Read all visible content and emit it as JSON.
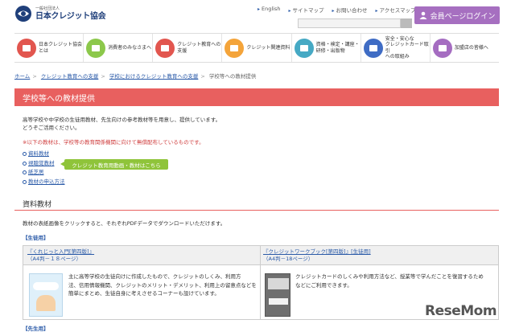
{
  "header": {
    "logo_small": "一般社団法人",
    "logo_main": "日本クレジット協会",
    "util_links": [
      "English",
      "サイトマップ",
      "お問い合わせ",
      "アクセスマップ"
    ],
    "login_label": "会員ページログイン"
  },
  "nav": [
    {
      "label": "日本クレジット協会\nとは",
      "color": "#e2564f"
    },
    {
      "label": "消費者のみなさまへ",
      "color": "#8cc84b"
    },
    {
      "label": "クレジット教育への\n支援",
      "color": "#e2564f"
    },
    {
      "label": "クレジット関連資料",
      "color": "#f4a43a"
    },
    {
      "label": "資格・検定・講座・\n研修・出版物",
      "color": "#46a9c4"
    },
    {
      "label": "安全・安心な\nクレジットカード取引\nへの取組み",
      "color": "#3f6cc4"
    },
    {
      "label": "加盟店の皆様へ",
      "color": "#a56dc1"
    }
  ],
  "breadcrumb": [
    {
      "label": "ホーム",
      "link": true
    },
    {
      "label": "クレジット教育への支援",
      "link": true
    },
    {
      "label": "学校におけるクレジット教育への支援",
      "link": true
    },
    {
      "label": "学校等への教材提供",
      "link": false
    }
  ],
  "page_title": "学校等への教材提供",
  "intro_line1": "高等学校や中学校の生徒用教材、先生向けの参考教材等を用意し、提供しています。",
  "intro_line2": "どうぞご活用ください。",
  "note": "※以下の教材は、学校等の教育関係機関に向けて無償配布しているものです。",
  "toc": [
    "資料教材",
    "視聴覚教材",
    "紙芝居",
    "教材の申込方法"
  ],
  "video_button": "クレジット教育用動画・教材はこちら",
  "section_title": "資料教材",
  "section_desc": "教材の表紙画像をクリックすると、それぞれPDFデータでダウンロードいただけます。",
  "category1": "【生徒用】",
  "category2": "【先生用】",
  "materials": [
    {
      "title": "『くれじっと入門[第四版]』",
      "spec": "（A4判－１８ページ）",
      "desc": [
        "主に高等学校の生徒向けに作成したもので、クレジットのしくみ、利用方",
        "法、信用情報機関、クレジットのメリット・デメリット、利用上の留意点などを",
        "簡単にまとめ、生徒自身に考えさせるコーナーも設けています。"
      ]
    },
    {
      "title": "『クレジットワークブック[第四版]』[生徒用]",
      "spec": "（A4判－18ページ）",
      "desc": [
        "クレジットカードのしくみや利用方法など、授業等で学んだことを復習するため",
        "などにご利用できます。"
      ]
    }
  ],
  "watermark": "ReseMom"
}
